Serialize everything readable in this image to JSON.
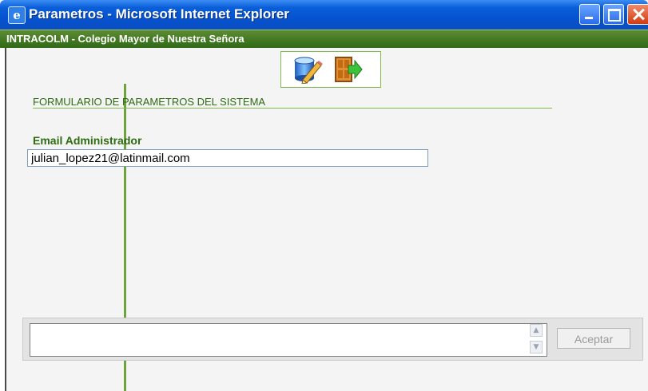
{
  "window": {
    "title": "Parametros - Microsoft Internet Explorer",
    "icon": "ie-icon"
  },
  "header": {
    "title": "INTRACOLM - Colegio Mayor de Nuestra Señora"
  },
  "toolbar": {
    "save_icon": "database-edit-icon",
    "exit_icon": "exit-door-icon"
  },
  "form": {
    "section_title": "FORMULARIO DE PARAMETROS DEL SISTEMA",
    "email_label": "Email Administrador",
    "email_value": "julian_lopez21@latinmail.com"
  },
  "bottom": {
    "message": "",
    "accept_label": "Aceptar"
  },
  "colors": {
    "titlebar": "#0553d0",
    "header": "#2f6a16",
    "accent_green": "#6ea33d",
    "label_green": "#2e6b12"
  }
}
